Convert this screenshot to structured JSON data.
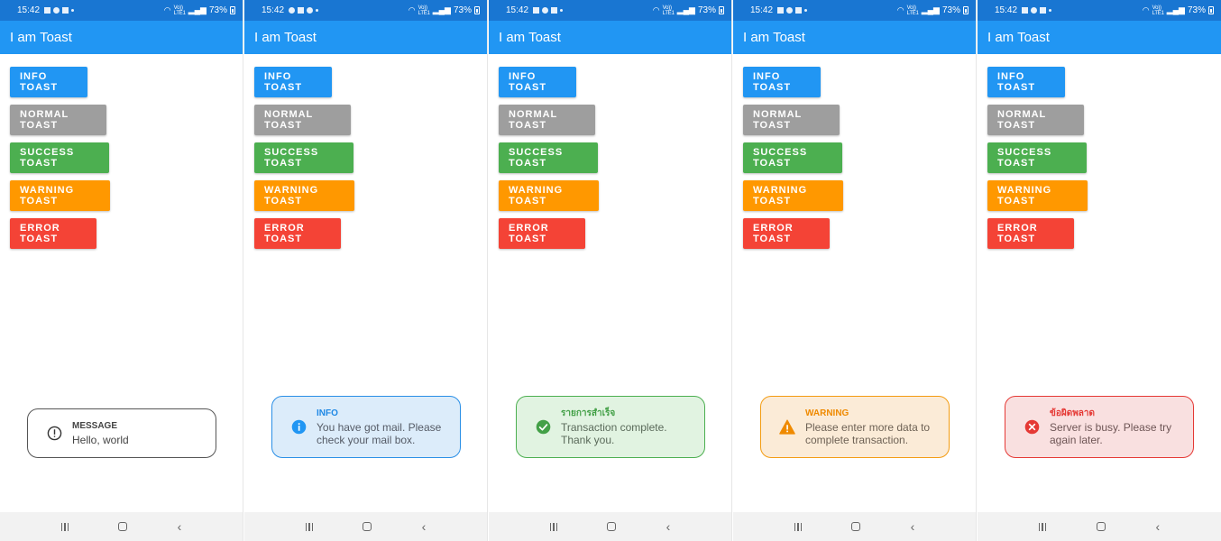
{
  "status": {
    "time": "15:42",
    "battery": "73%",
    "network_top": "Vo))",
    "network_bottom": "LTE1"
  },
  "app": {
    "title": "I am Toast"
  },
  "buttons": {
    "info": "INFO TOAST",
    "normal": "NORMAL TOAST",
    "success": "SUCCESS TOAST",
    "warning": "WARNING TOAST",
    "error": "ERROR TOAST"
  },
  "screens": [
    {
      "toast": {
        "kind": "message",
        "icon": "exclamation-circle-icon",
        "title": "MESSAGE",
        "message": "Hello, world",
        "color": "#555555"
      }
    },
    {
      "toast": {
        "kind": "info",
        "icon": "info-circle-icon",
        "title": "INFO",
        "message": "You have got mail. Please check your mail box.",
        "color": "#2196f3"
      }
    },
    {
      "toast": {
        "kind": "success",
        "icon": "check-circle-icon",
        "title": "รายการสำเร็จ",
        "message": "Transaction complete. Thank you.",
        "color": "#4caf50"
      }
    },
    {
      "toast": {
        "kind": "warning",
        "icon": "warning-triangle-icon",
        "title": "WARNING",
        "message": "Please enter more data to complete transaction.",
        "color": "#ff9800"
      }
    },
    {
      "toast": {
        "kind": "error",
        "icon": "error-circle-icon",
        "title": "ข้อผิดพลาด",
        "message": "Server is busy. Please try again later.",
        "color": "#f44336"
      }
    }
  ],
  "colors": {
    "status_bar": "#1976d2",
    "app_bar": "#2196f3",
    "info": "#2196f3",
    "normal": "#9e9e9e",
    "success": "#4caf50",
    "warning": "#ff9800",
    "error": "#f44336"
  }
}
